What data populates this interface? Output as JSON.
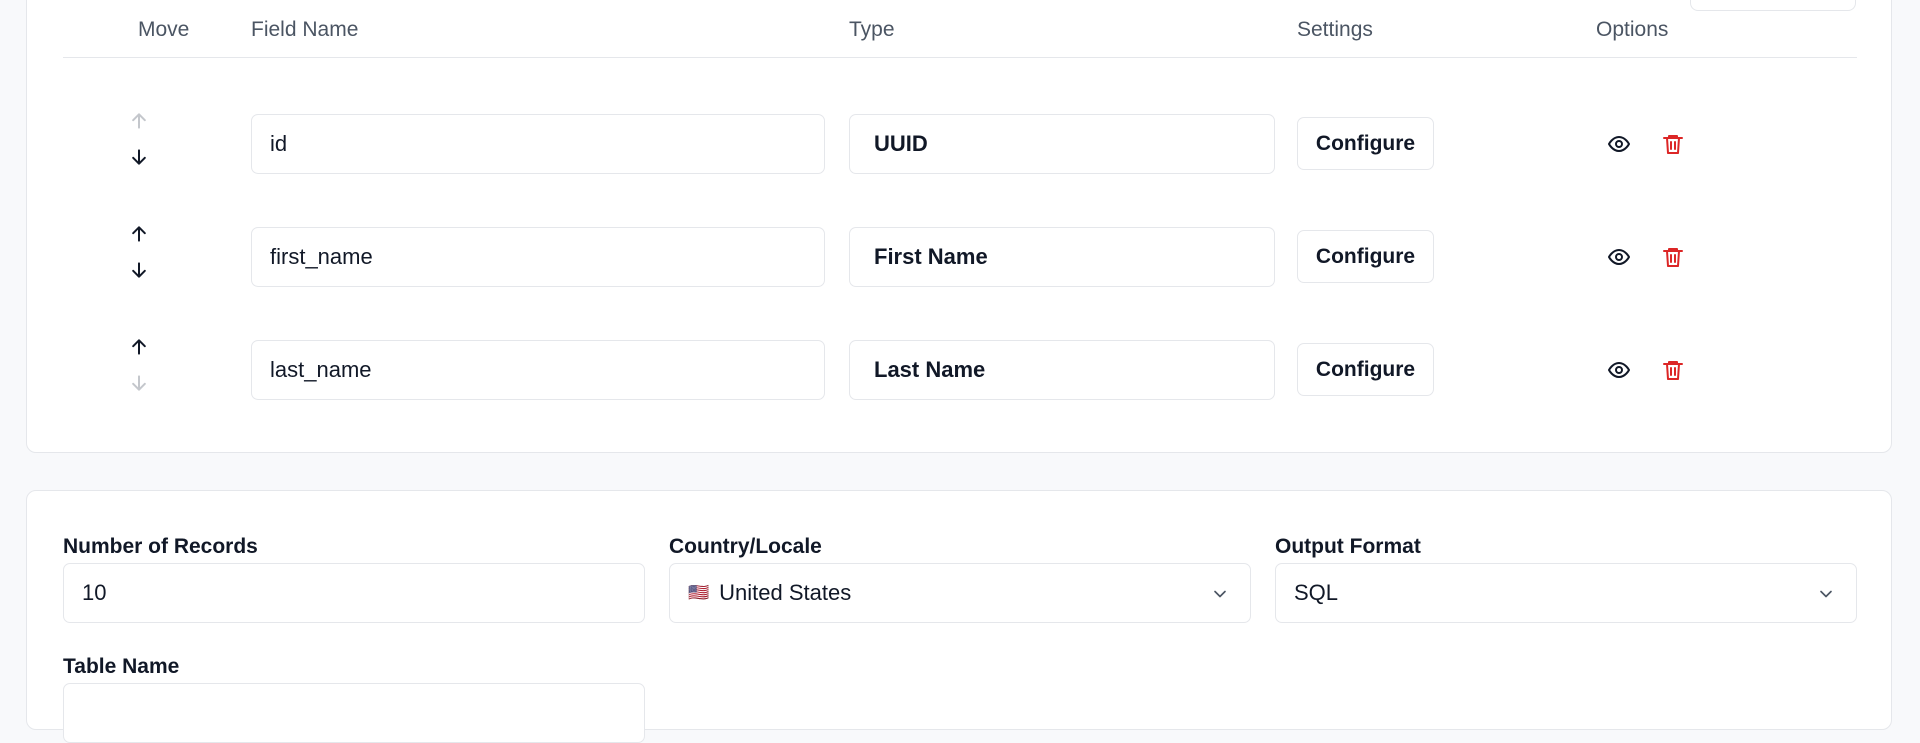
{
  "table": {
    "headers": {
      "move": "Move",
      "field_name": "Field Name",
      "type": "Type",
      "settings": "Settings",
      "options": "Options"
    },
    "rows": [
      {
        "name": "id",
        "type": "UUID",
        "configure_label": "Configure",
        "up_disabled": true,
        "down_disabled": false
      },
      {
        "name": "first_name",
        "type": "First Name",
        "configure_label": "Configure",
        "up_disabled": false,
        "down_disabled": false
      },
      {
        "name": "last_name",
        "type": "Last Name",
        "configure_label": "Configure",
        "up_disabled": false,
        "down_disabled": true
      }
    ]
  },
  "settings": {
    "records_label": "Number of Records",
    "records_value": "10",
    "locale_label": "Country/Locale",
    "locale_flag": "🇺🇸",
    "locale_value": "United States",
    "format_label": "Output Format",
    "format_value": "SQL",
    "table_name_label": "Table Name",
    "table_name_value": ""
  },
  "colors": {
    "delete_icon": "#dc2626",
    "border": "#e5e7eb",
    "muted_text": "#4b5563"
  },
  "icons": {
    "move_up": "arrow-up-icon",
    "move_down": "arrow-down-icon",
    "visibility": "eye-icon",
    "delete": "trash-icon",
    "dropdown": "chevron-down-icon"
  }
}
